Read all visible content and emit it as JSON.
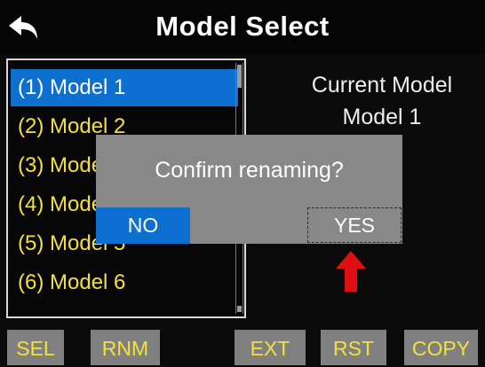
{
  "header": {
    "title": "Model Select",
    "back_icon": "back-arrow-icon"
  },
  "model_list": {
    "items": [
      {
        "label": "(1) Model 1",
        "selected": true
      },
      {
        "label": "(2) Model 2",
        "selected": false
      },
      {
        "label": "(3) Model 3",
        "selected": false
      },
      {
        "label": "(4) Model 4",
        "selected": false
      },
      {
        "label": "(5) Model 5",
        "selected": false
      },
      {
        "label": "(6) Model 6",
        "selected": false
      }
    ]
  },
  "current": {
    "label": "Current Model",
    "value": "Model 1"
  },
  "dialog": {
    "message": "Confirm renaming?",
    "no_label": "NO",
    "yes_label": "YES"
  },
  "softkeys": [
    "SEL",
    "RNM",
    "EXT",
    "RST",
    "COPY"
  ],
  "colors": {
    "selection": "#0d6fcf",
    "list_text": "#f4e03a",
    "dialog_bg": "#888888",
    "arrow": "#e01010",
    "softkey_bg": "#808080"
  }
}
